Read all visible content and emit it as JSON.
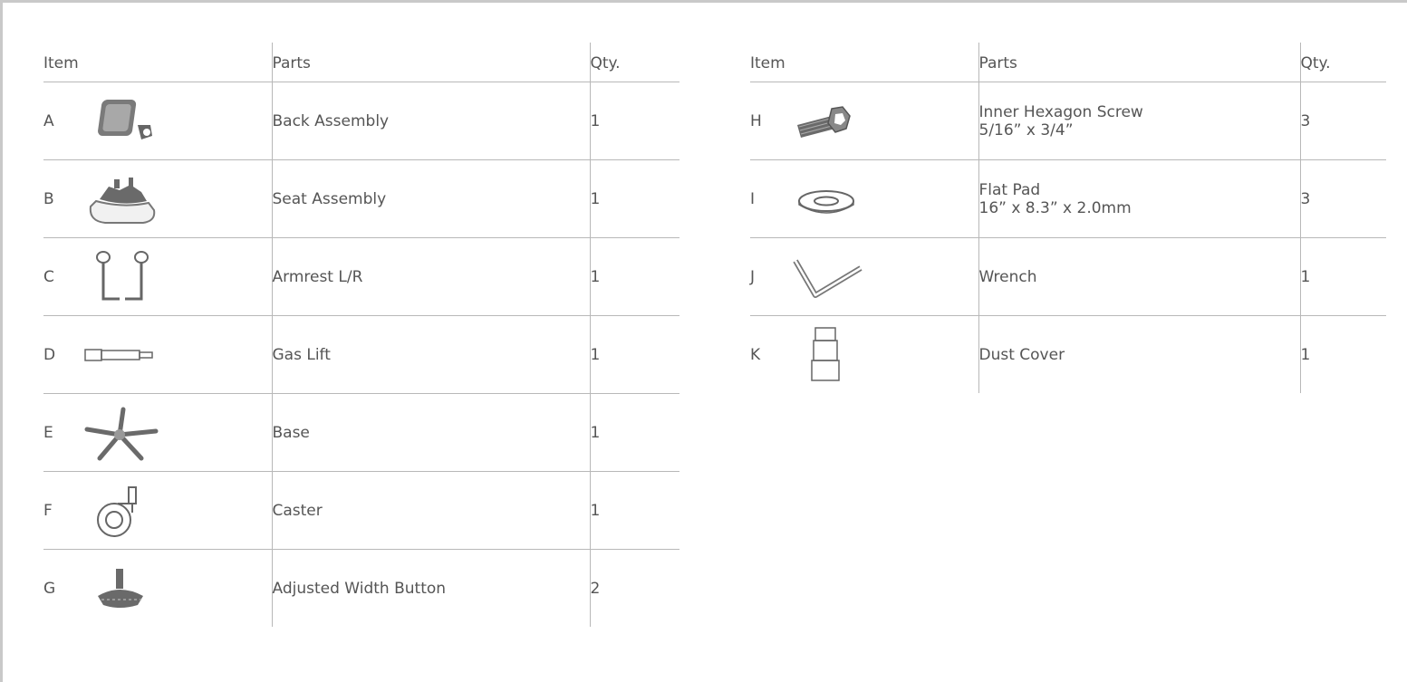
{
  "headers": {
    "item": "Item",
    "parts": "Parts",
    "qty": "Qty."
  },
  "left_table": [
    {
      "letter": "A",
      "icon": "back-assembly-icon",
      "name": "Back Assembly",
      "spec": "",
      "qty": "1"
    },
    {
      "letter": "B",
      "icon": "seat-assembly-icon",
      "name": "Seat Assembly",
      "spec": "",
      "qty": "1"
    },
    {
      "letter": "C",
      "icon": "armrest-icon",
      "name": "Armrest L/R",
      "spec": "",
      "qty": "1"
    },
    {
      "letter": "D",
      "icon": "gas-lift-icon",
      "name": "Gas Lift",
      "spec": "",
      "qty": "1"
    },
    {
      "letter": "E",
      "icon": "base-icon",
      "name": "Base",
      "spec": "",
      "qty": "1"
    },
    {
      "letter": "F",
      "icon": "caster-icon",
      "name": "Caster",
      "spec": "",
      "qty": "1"
    },
    {
      "letter": "G",
      "icon": "width-button-icon",
      "name": "Adjusted Width Button",
      "spec": "",
      "qty": "2"
    }
  ],
  "right_table": [
    {
      "letter": "H",
      "icon": "hexagon-screw-icon",
      "name": "Inner Hexagon Screw",
      "spec": "5/16” x 3/4”",
      "qty": "3"
    },
    {
      "letter": "I",
      "icon": "flat-pad-icon",
      "name": "Flat Pad",
      "spec": "16” x 8.3” x 2.0mm",
      "qty": "3"
    },
    {
      "letter": "J",
      "icon": "wrench-icon",
      "name": "Wrench",
      "spec": "",
      "qty": "1"
    },
    {
      "letter": "K",
      "icon": "dust-cover-icon",
      "name": "Dust Cover",
      "spec": "",
      "qty": "1"
    }
  ],
  "colors": {
    "text": "#555555",
    "rule": "#b8b8b8",
    "frame": "#c9c9c9",
    "icon_fill": "#7a7a7a"
  }
}
